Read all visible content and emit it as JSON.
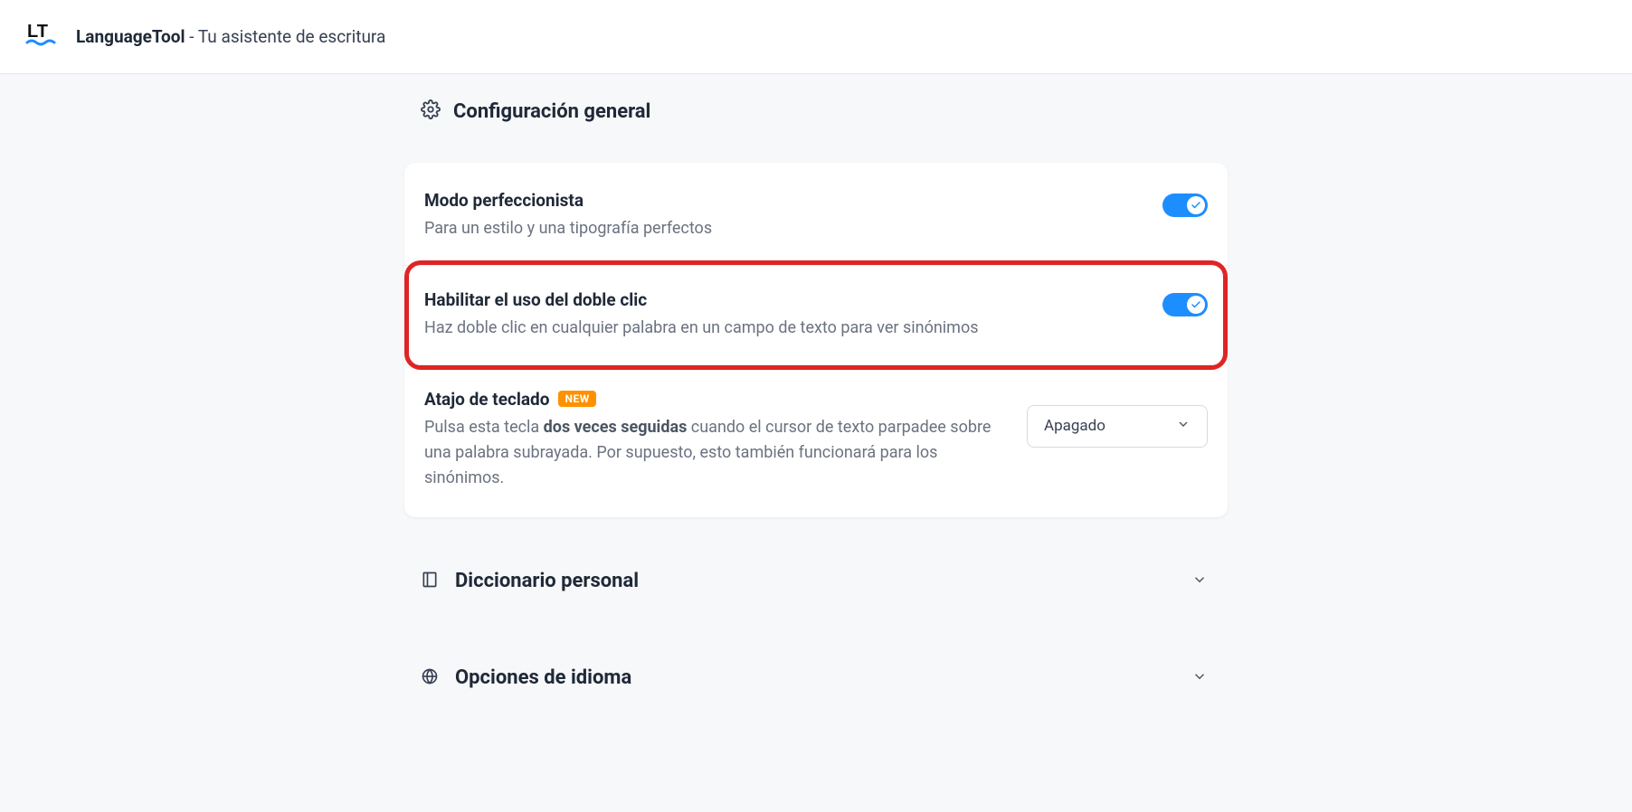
{
  "header": {
    "brand": "LanguageTool",
    "tagline": "Tu asistente de escritura"
  },
  "sections": {
    "general": {
      "title": "Configuración general",
      "rows": {
        "perfectionist": {
          "title": "Modo perfeccionista",
          "desc": "Para un estilo y una tipografía perfectos",
          "toggle_on": true
        },
        "doubleclick": {
          "title": "Habilitar el uso del doble clic",
          "desc": "Haz doble clic en cualquier palabra en un campo de texto para ver sinónimos",
          "toggle_on": true,
          "highlighted": true
        },
        "shortcut": {
          "title": "Atajo de teclado",
          "badge": "NEW",
          "desc_pre": "Pulsa esta tecla ",
          "desc_bold": "dos veces seguidas",
          "desc_post": " cuando el cursor de texto parpadee sobre una palabra subrayada. Por supuesto, esto también funcionará para los sinónimos.",
          "select_value": "Apagado"
        }
      }
    },
    "dictionary": {
      "title": "Diccionario personal"
    },
    "language": {
      "title": "Opciones de idioma"
    }
  }
}
